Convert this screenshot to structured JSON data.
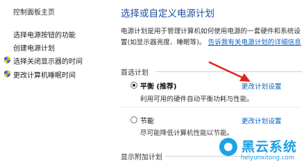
{
  "sidebar": {
    "home": "控制面板主页",
    "items": [
      {
        "label": "选择电源按钮的功能",
        "shield": false
      },
      {
        "label": "创建电源计划",
        "shield": false
      },
      {
        "label": "选择关闭显示器的时间",
        "shield": true
      },
      {
        "label": "更改计算机睡眠时间",
        "shield": true
      }
    ]
  },
  "main": {
    "title": "选择或自定义电源计划",
    "description": "电源计划是用于管理计算机如何使用电源的一套硬件和系统设置(如显示器亮度、睡眠等)。",
    "description_link": "告诉我有关电源计划的详细信息",
    "preferred_label": "首选计划",
    "plans": [
      {
        "name": "平衡 (推荐)",
        "selected": true,
        "bold": true,
        "description": "利用可用的硬件自动平衡功耗与性能。",
        "link": "更改计划设置"
      },
      {
        "name": "节能",
        "selected": false,
        "bold": false,
        "description": "尽可能降低计算机性能以节能。",
        "link": "更改计划设置"
      }
    ],
    "additional_label": "显示附加计划"
  },
  "watermark": {
    "title": "黑云系统",
    "url": "heiyunxitong.com"
  },
  "colors": {
    "title": "#1b4e9c",
    "link": "#0b62c4",
    "arrow": "#e0231b",
    "watermark": "#1aa0e4"
  }
}
